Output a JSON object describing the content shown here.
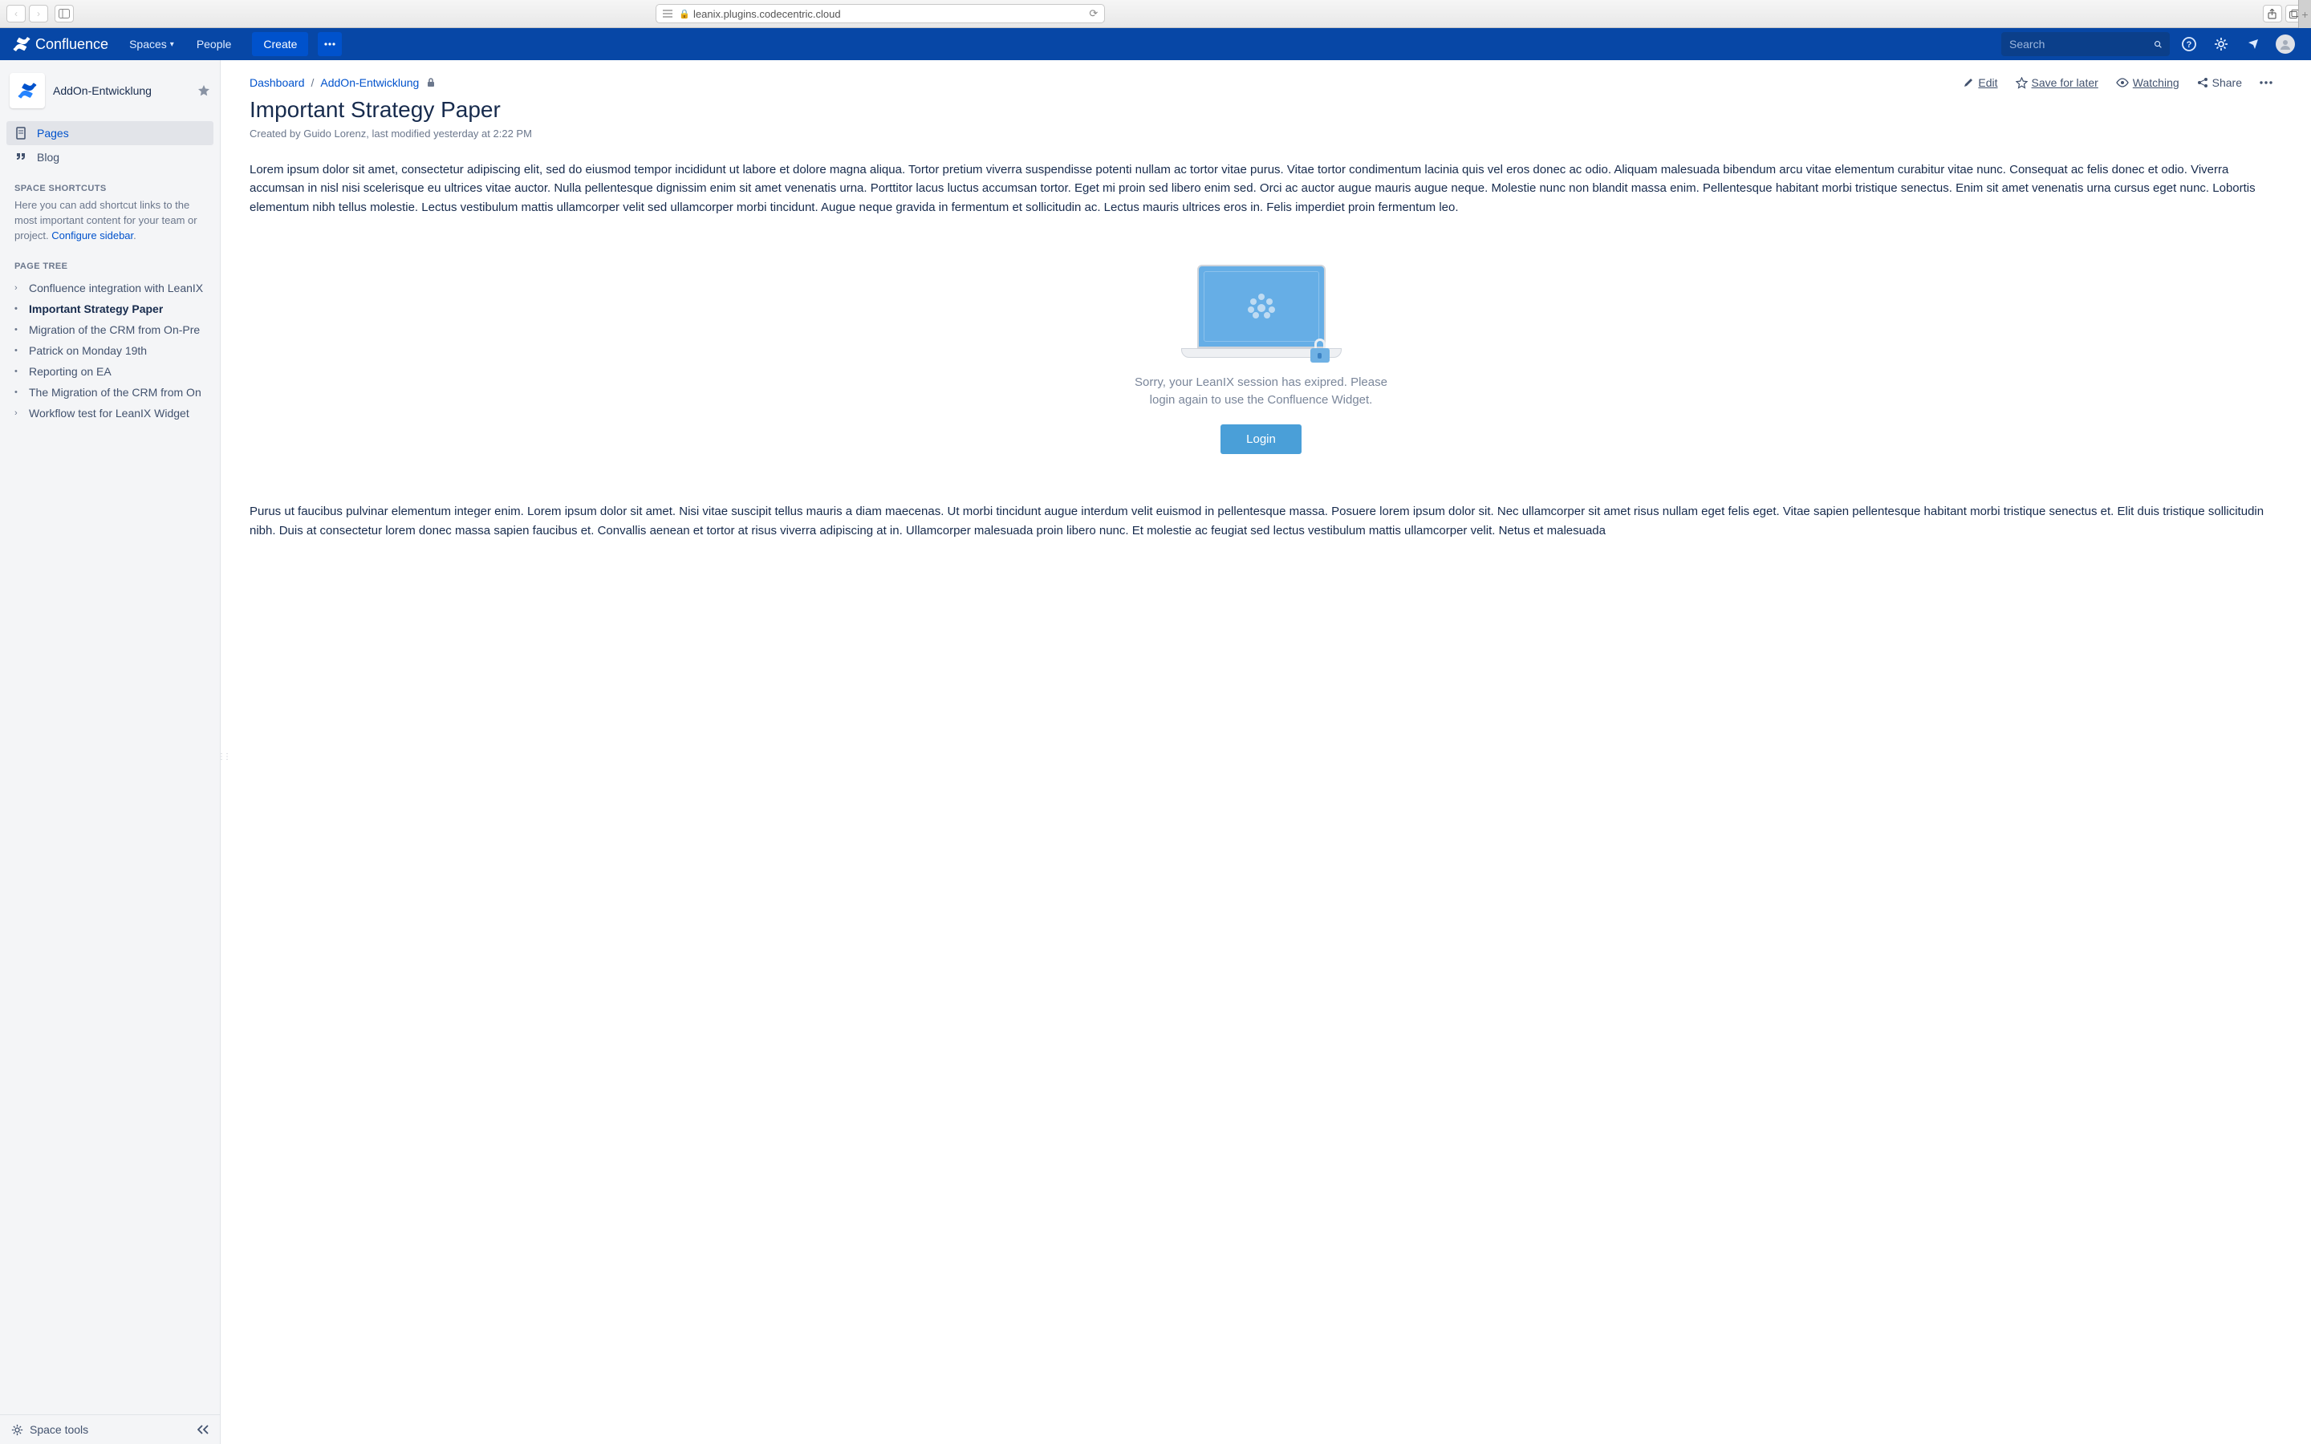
{
  "browser": {
    "url_host": "leanix.plugins.codecentric.cloud"
  },
  "header": {
    "product": "Confluence",
    "nav": {
      "spaces": "Spaces",
      "people": "People"
    },
    "create": "Create",
    "search_placeholder": "Search"
  },
  "sidebar": {
    "space_name": "AddOn-Entwicklung",
    "nav": {
      "pages": "Pages",
      "blog": "Blog"
    },
    "shortcuts_heading": "SPACE SHORTCUTS",
    "shortcuts_text": "Here you can add shortcut links to the most important content for your team or project. ",
    "configure_link": "Configure sidebar",
    "tree_heading": "PAGE TREE",
    "tree": [
      {
        "label": "Confluence integration with LeanIX",
        "expander": ">"
      },
      {
        "label": "Important Strategy Paper",
        "expander": "•",
        "current": true
      },
      {
        "label": "Migration of the CRM from On-Pre",
        "expander": "•"
      },
      {
        "label": "Patrick on Monday 19th",
        "expander": "•"
      },
      {
        "label": "Reporting on EA",
        "expander": "•"
      },
      {
        "label": "The Migration of the CRM from On",
        "expander": "•"
      },
      {
        "label": "Workflow test for LeanIX Widget",
        "expander": ">"
      }
    ],
    "footer": "Space tools"
  },
  "breadcrumbs": {
    "items": [
      "Dashboard",
      "AddOn-Entwicklung"
    ]
  },
  "page_actions": {
    "edit": "Edit",
    "save": "Save for later",
    "watching": "Watching",
    "share": "Share"
  },
  "page": {
    "title": "Important Strategy Paper",
    "byline": "Created by Guido Lorenz, last modified yesterday at 2:22 PM",
    "para1": "Lorem ipsum dolor sit amet, consectetur adipiscing elit, sed do eiusmod tempor incididunt ut labore et dolore magna aliqua. Tortor pretium viverra suspendisse potenti nullam ac tortor vitae purus. Vitae tortor condimentum lacinia quis vel eros donec ac odio. Aliquam malesuada bibendum arcu vitae elementum curabitur vitae nunc. Consequat ac felis donec et odio. Viverra accumsan in nisl nisi scelerisque eu ultrices vitae auctor. Nulla pellentesque dignissim enim sit amet venenatis urna. Porttitor lacus luctus accumsan tortor. Eget mi proin sed libero enim sed. Orci ac auctor augue mauris augue neque. Molestie nunc non blandit massa enim. Pellentesque habitant morbi tristique senectus. Enim sit amet venenatis urna cursus eget nunc. Lobortis elementum nibh tellus molestie. Lectus vestibulum mattis ullamcorper velit sed ullamcorper morbi tincidunt. Augue neque gravida in fermentum et sollicitudin ac. Lectus mauris ultrices eros in. Felis imperdiet proin fermentum leo.",
    "para2": "Purus ut faucibus pulvinar elementum integer enim. Lorem ipsum dolor sit amet. Nisi vitae suscipit tellus mauris a diam maecenas. Ut morbi tincidunt augue interdum velit euismod in pellentesque massa. Posuere lorem ipsum dolor sit. Nec ullamcorper sit amet risus nullam eget felis eget. Vitae sapien pellentesque habitant morbi tristique senectus et. Elit duis tristique sollicitudin nibh. Duis at consectetur lorem donec massa sapien faucibus et. Convallis aenean et tortor at risus viverra adipiscing at in. Ullamcorper malesuada proin libero nunc. Et molestie ac feugiat sed lectus vestibulum mattis ullamcorper velit. Netus et malesuada"
  },
  "widget": {
    "message": "Sorry, your LeanIX session has exipred. Please login again to use the Confluence Widget.",
    "login": "Login"
  }
}
